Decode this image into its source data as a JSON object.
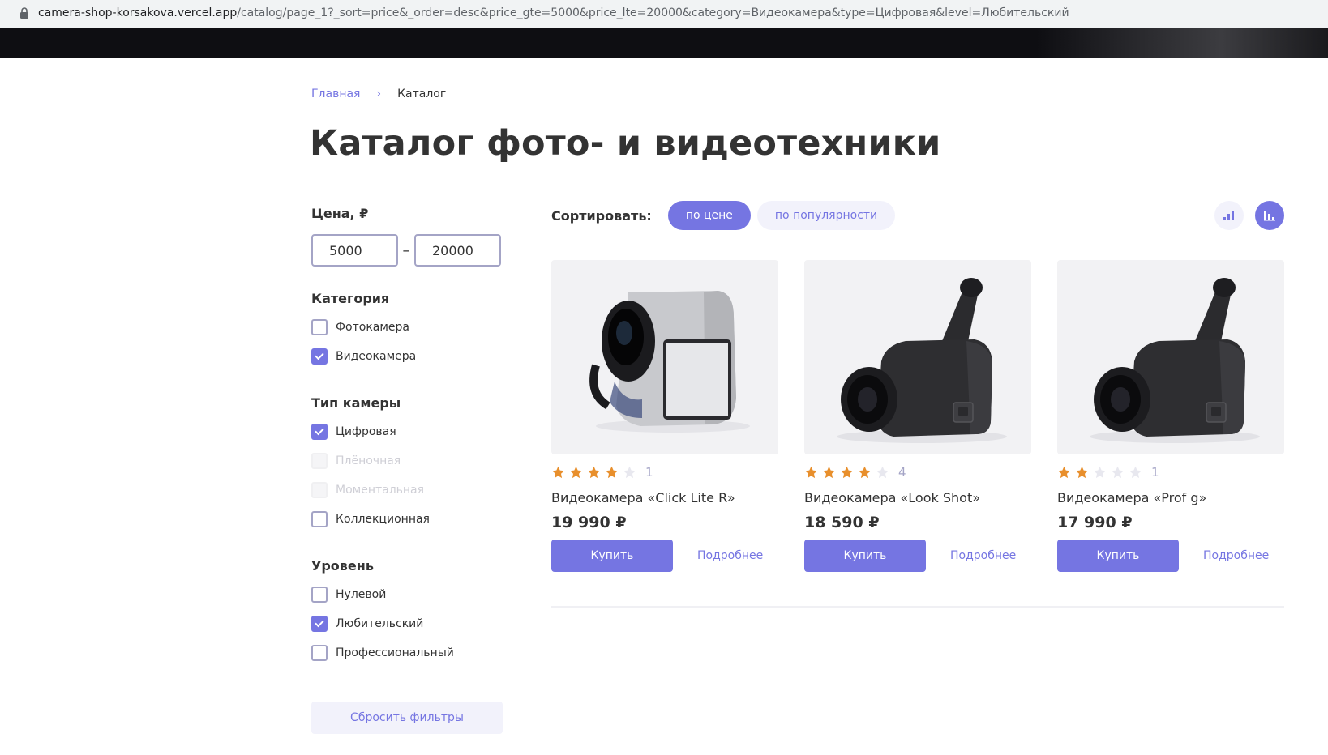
{
  "browser": {
    "url_host": "camera-shop-korsakova.vercel.app",
    "url_path": "/catalog/page_1?_sort=price&_order=desc&price_gte=5000&price_lte=20000&category=Видеокамера&type=Цифровая&level=Любительский"
  },
  "breadcrumb": {
    "home": "Главная",
    "separator": "›",
    "current": "Каталог"
  },
  "page_title": "Каталог фото- и видеотехники",
  "filters": {
    "price": {
      "title": "Цена, ₽",
      "from": "5000",
      "to": "20000",
      "dash": "–"
    },
    "category": {
      "title": "Категория",
      "items": [
        {
          "label": "Фотокамера",
          "checked": false,
          "disabled": false
        },
        {
          "label": "Видеокамера",
          "checked": true,
          "disabled": false
        }
      ]
    },
    "type": {
      "title": "Тип камеры",
      "items": [
        {
          "label": "Цифровая",
          "checked": true,
          "disabled": false
        },
        {
          "label": "Плёночная",
          "checked": false,
          "disabled": true
        },
        {
          "label": "Моментальная",
          "checked": false,
          "disabled": true
        },
        {
          "label": "Коллекционная",
          "checked": false,
          "disabled": false
        }
      ]
    },
    "level": {
      "title": "Уровень",
      "items": [
        {
          "label": "Нулевой",
          "checked": false,
          "disabled": false
        },
        {
          "label": "Любительский",
          "checked": true,
          "disabled": false
        },
        {
          "label": "Профессиональный",
          "checked": false,
          "disabled": false
        }
      ]
    },
    "reset_label": "Сбросить фильтры"
  },
  "sort": {
    "label": "Сортировать:",
    "by_price": "по цене",
    "by_popularity": "по популярности",
    "active": "price",
    "order": "desc"
  },
  "colors": {
    "accent": "#7575e2",
    "star": "#e88f2c",
    "star_empty": "#e8e8ef"
  },
  "products": [
    {
      "name": "Видеокамера «Click Lite R»",
      "rating": 4,
      "reviews": "1",
      "price": "19 990 ₽",
      "buy_label": "Купить",
      "more_label": "Подробнее",
      "image": "silver-camcorder"
    },
    {
      "name": "Видеокамера «Look Shot»",
      "rating": 4,
      "reviews": "4",
      "price": "18 590 ₽",
      "buy_label": "Купить",
      "more_label": "Подробнее",
      "image": "black-camcorder"
    },
    {
      "name": "Видеокамера «Prof g»",
      "rating": 2,
      "reviews": "1",
      "price": "17 990 ₽",
      "buy_label": "Купить",
      "more_label": "Подробнее",
      "image": "black-camcorder"
    }
  ]
}
